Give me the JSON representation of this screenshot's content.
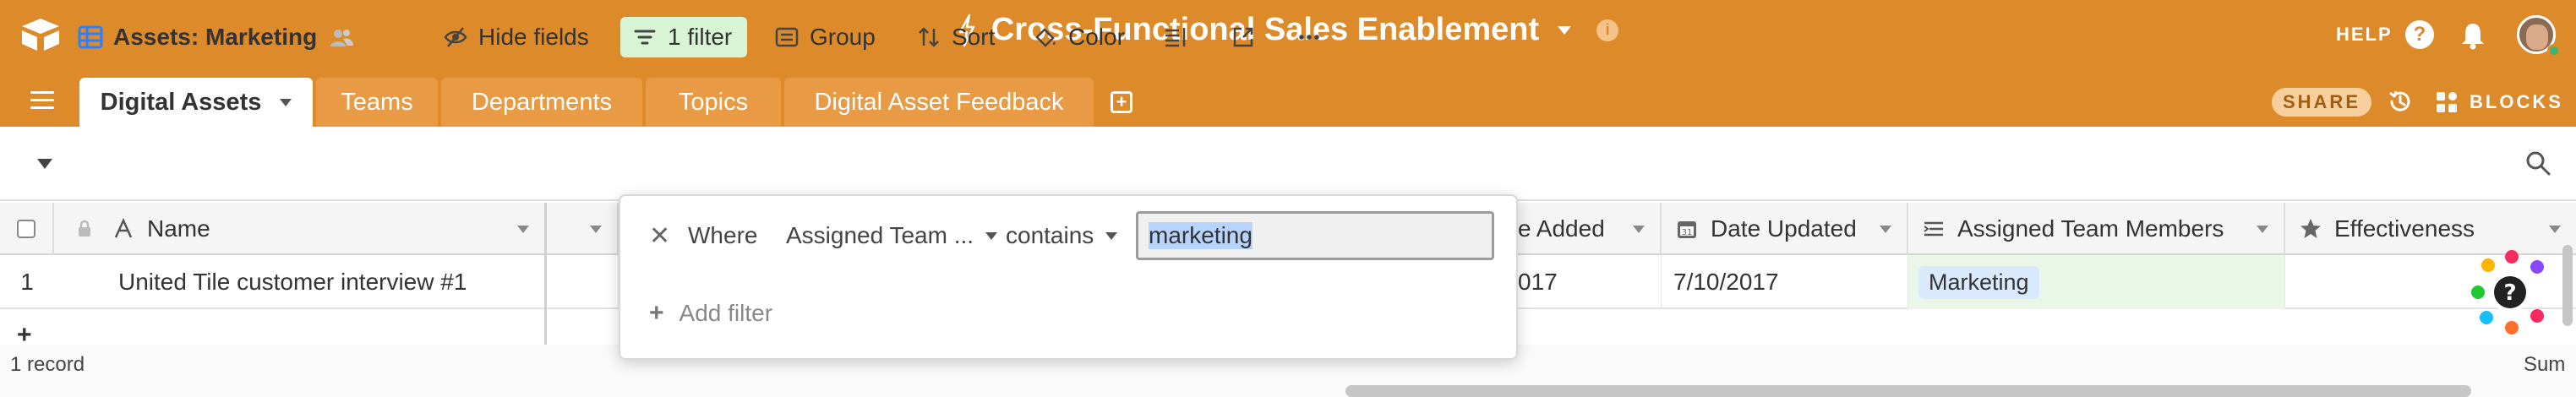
{
  "app": {
    "base_title": "Cross-Functional Sales Enablement",
    "help_label": "HELP",
    "share_label": "SHARE",
    "blocks_label": "BLOCKS"
  },
  "tabs": [
    {
      "label": "Digital Assets",
      "active": true
    },
    {
      "label": "Teams",
      "active": false
    },
    {
      "label": "Departments",
      "active": false
    },
    {
      "label": "Topics",
      "active": false
    },
    {
      "label": "Digital Asset Feedback",
      "active": false
    }
  ],
  "toolbar": {
    "view_name": "Assets: Marketing",
    "hide_fields": "Hide fields",
    "filter": "1 filter",
    "group": "Group",
    "sort": "Sort",
    "color": "Color"
  },
  "columns": [
    {
      "label": "Name",
      "icon": "text-icon"
    },
    {
      "label": "e Added",
      "icon": "calendar-icon"
    },
    {
      "label": "Date Updated",
      "icon": "calendar-icon"
    },
    {
      "label": "Assigned Team Members",
      "icon": "lookup-icon"
    },
    {
      "label": "Effectiveness",
      "icon": "star-icon"
    }
  ],
  "rows": [
    {
      "number": "1",
      "name": "United Tile customer interview #1",
      "date_added": "017",
      "date_updated": "7/10/2017",
      "assigned_team": "Marketing"
    }
  ],
  "filter": {
    "where": "Where",
    "field": "Assigned Team ...",
    "operator": "contains",
    "value": "marketing",
    "add_filter": "Add filter"
  },
  "footer": {
    "record_count": "1 record",
    "summary": "Sum"
  },
  "colors": {
    "brand_orange": "#dc8a2a",
    "filter_active": "#d7f5d4",
    "selection": "#b9d3ff"
  }
}
